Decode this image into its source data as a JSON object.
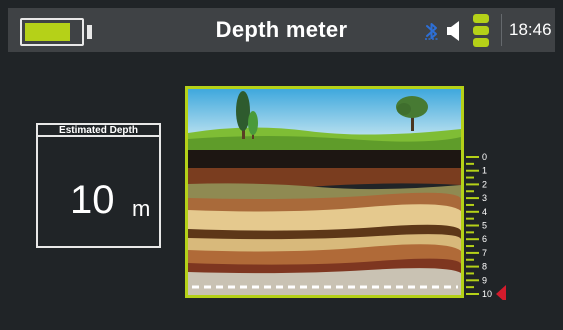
{
  "header": {
    "title": "Depth meter",
    "battery_level": 0.8,
    "time": "18:46"
  },
  "icons": {
    "battery": "battery-icon",
    "bluetooth": "bluetooth-icon",
    "speaker": "speaker-icon",
    "signal": "signal-icon"
  },
  "depth_panel": {
    "label": "Estimated Depth",
    "value": "10",
    "unit": "m"
  },
  "scale": {
    "ticks": [
      "0",
      "1",
      "2",
      "3",
      "4",
      "5",
      "6",
      "7",
      "8",
      "9",
      "10"
    ],
    "current_depth_index": 10
  },
  "colors": {
    "accent": "#b5d118",
    "indicator": "#d41b2c",
    "bluetooth": "#2d6fd6",
    "topbar": "#3f4245",
    "background": "#202427"
  }
}
